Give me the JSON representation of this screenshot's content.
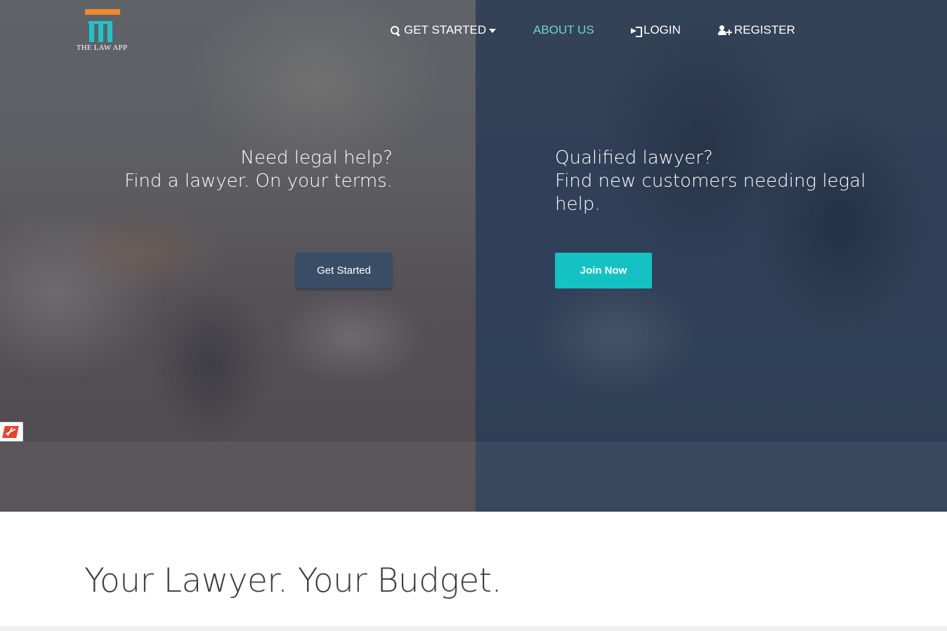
{
  "brand": {
    "name": "THE LAW APP",
    "colors": {
      "bar": "#f08a2a",
      "columns": "#20c4c7"
    }
  },
  "nav": {
    "items": [
      {
        "label": "GET STARTED",
        "icon": "search-icon",
        "has_dropdown": true
      },
      {
        "label": "ABOUT US",
        "active": true
      },
      {
        "label": "LOGIN",
        "icon": "sign-in-icon"
      },
      {
        "label": "REGISTER",
        "icon": "user-plus-icon"
      }
    ],
    "active_color": "#6fd3da"
  },
  "hero": {
    "left": {
      "line1": "Need legal help?",
      "line2": "Find a lawyer. On your terms.",
      "button_label": "Get Started",
      "button_color": "#3a4d66"
    },
    "right": {
      "line1": "Qualified lawyer?",
      "line2": "Find new customers needing legal help.",
      "button_label": "Join Now",
      "button_color": "#14c2c4"
    }
  },
  "feedback_widget": {
    "icon": "feedback-icon"
  },
  "tagline": "Your Lawyer. Your Budget."
}
